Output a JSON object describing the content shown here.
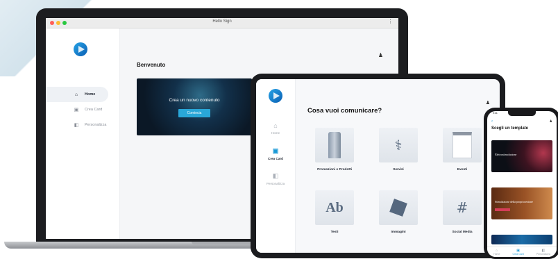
{
  "colors": {
    "accent": "#29a7d8",
    "logo": "#1c9ad6",
    "dark_card": "#0b1826"
  },
  "laptop": {
    "window_title": "Hello Sign",
    "sidebar": {
      "items": [
        {
          "label": "Home",
          "icon": "home-icon",
          "glyph": "⌂"
        },
        {
          "label": "Crea Card",
          "icon": "card-icon",
          "glyph": "▣"
        },
        {
          "label": "Personalizza",
          "icon": "customize-icon",
          "glyph": "◧"
        }
      ]
    },
    "main": {
      "welcome": "Benvenuto",
      "hero_title": "Crea un nuovo contenuto",
      "hero_button": "Comincia"
    }
  },
  "tablet": {
    "sidebar": {
      "items": [
        {
          "label": "Home",
          "glyph": "⌂"
        },
        {
          "label": "Crea Card",
          "glyph": "▣"
        },
        {
          "label": "Personalizza",
          "glyph": "◧"
        }
      ]
    },
    "title": "Cosa vuoi comunicare?",
    "tiles": [
      {
        "label": "Promozioni e Prodotti",
        "icon": "tube-icon"
      },
      {
        "label": "Servizi",
        "icon": "stethoscope-icon",
        "glyph": "⚕"
      },
      {
        "label": "Eventi",
        "icon": "calendar-icon"
      },
      {
        "label": "Testi",
        "icon": "text-icon",
        "glyph": "Ab"
      },
      {
        "label": "Immagini",
        "icon": "image-icon"
      },
      {
        "label": "Social Media",
        "icon": "hashtag-icon",
        "glyph": "#"
      }
    ]
  },
  "phone": {
    "time": "9:41",
    "title": "Scegli un template",
    "templates": [
      {
        "text": "Elettrostimolazione"
      },
      {
        "text": "Stimolazione della propriocezione"
      }
    ],
    "tabbar": [
      "Home",
      "Crea Card",
      "Personalizza"
    ]
  }
}
